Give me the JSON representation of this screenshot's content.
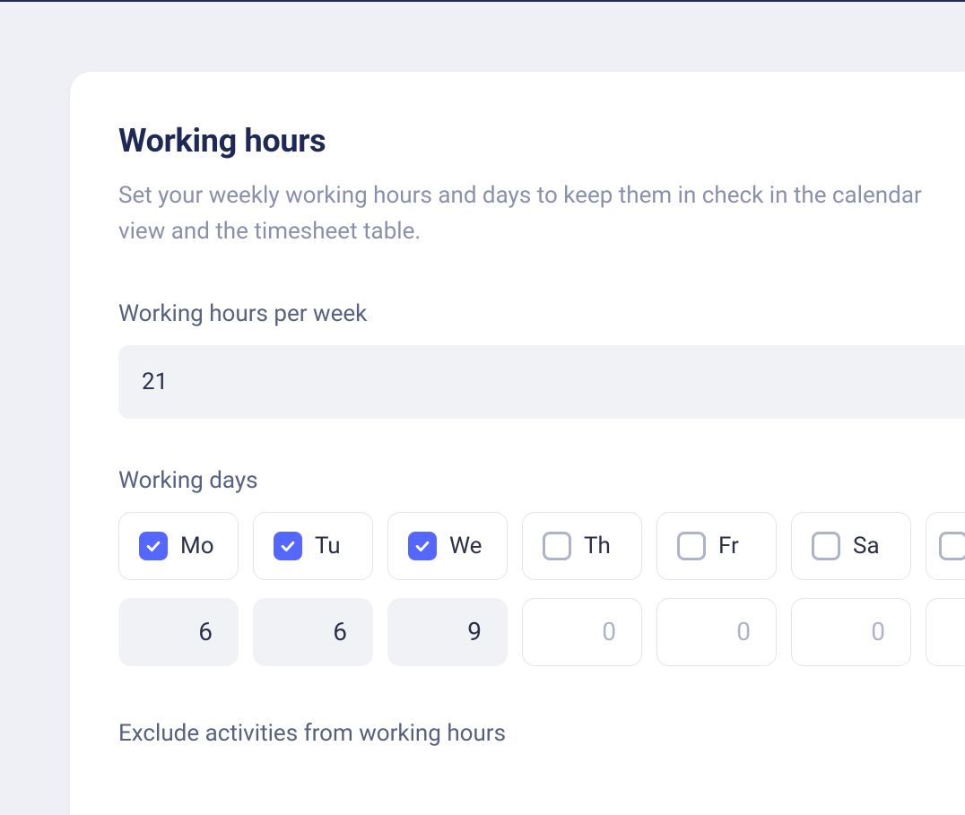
{
  "heading": "Working hours",
  "description": "Set your weekly working hours and days to keep them in check in the calendar view and the timesheet table.",
  "hoursPerWeek": {
    "label": "Working hours per week",
    "value": "21"
  },
  "workingDays": {
    "label": "Working days",
    "days": [
      {
        "abbr": "Mo",
        "checked": true,
        "hours": "6"
      },
      {
        "abbr": "Tu",
        "checked": true,
        "hours": "6"
      },
      {
        "abbr": "We",
        "checked": true,
        "hours": "9"
      },
      {
        "abbr": "Th",
        "checked": false,
        "hours": "0"
      },
      {
        "abbr": "Fr",
        "checked": false,
        "hours": "0"
      },
      {
        "abbr": "Sa",
        "checked": false,
        "hours": "0"
      },
      {
        "abbr": "",
        "checked": false,
        "hours": ""
      }
    ]
  },
  "exclude": {
    "label": "Exclude activities from working hours"
  }
}
